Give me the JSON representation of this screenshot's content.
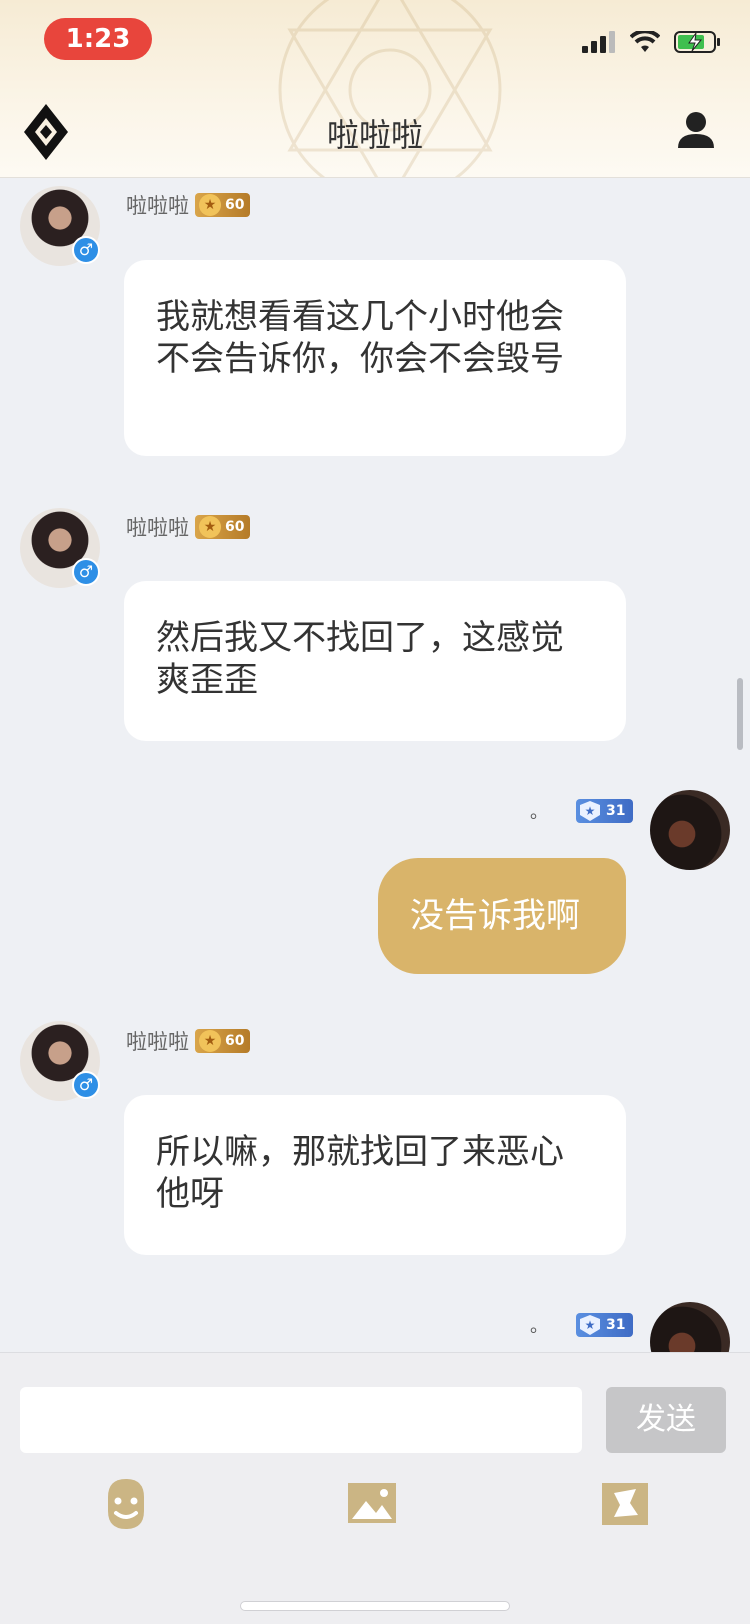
{
  "status_bar": {
    "time": "1:23"
  },
  "header": {
    "title": "啦啦啦"
  },
  "messages": [
    {
      "side": "left",
      "sender": "啦啦啦",
      "level": "60",
      "text": "我就想看看这几个小时他会不会告诉你，你会不会毁号"
    },
    {
      "side": "left",
      "sender": "啦啦啦",
      "level": "60",
      "text": "然后我又不找回了，这感觉爽歪歪"
    },
    {
      "side": "right",
      "sender": "。",
      "level": "31",
      "text": "没告诉我啊"
    },
    {
      "side": "left",
      "sender": "啦啦啦",
      "level": "60",
      "text": "所以嘛，那就找回了来恶心他呀"
    },
    {
      "side": "right",
      "sender": "。",
      "level": "31",
      "text": ""
    }
  ],
  "input": {
    "placeholder": "",
    "value": ""
  },
  "send_label": "发送",
  "gender_symbol": "♂",
  "icons": [
    "emoji-icon",
    "image-icon",
    "sticker-icon"
  ]
}
